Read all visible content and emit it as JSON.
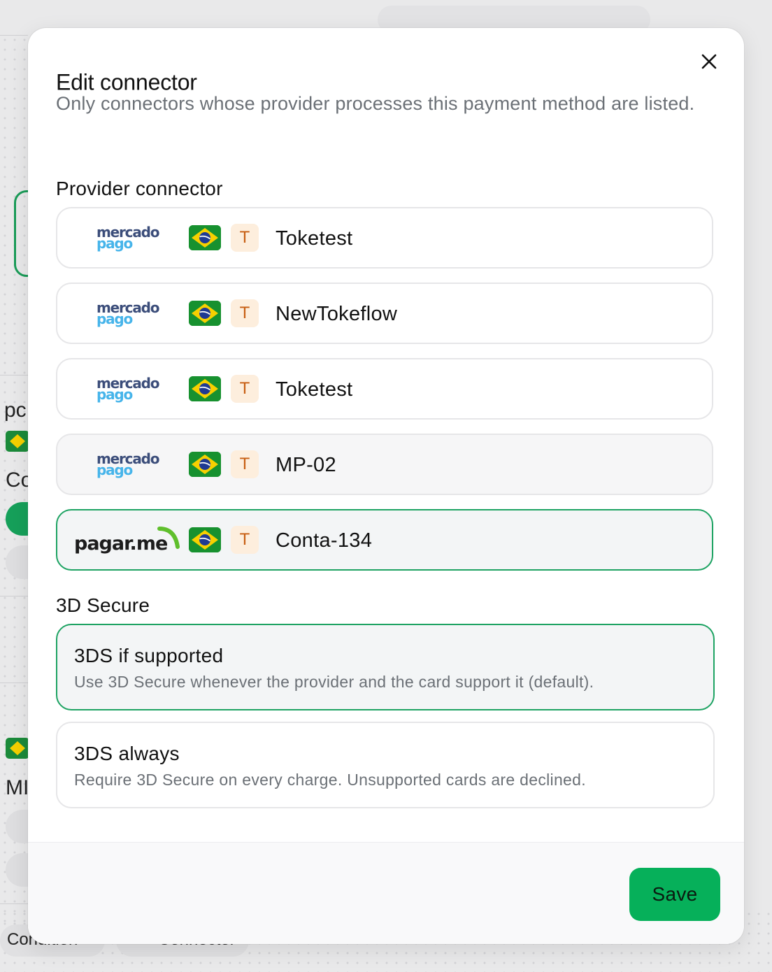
{
  "background": {
    "left_texts": [
      "pc",
      "Co",
      "MI"
    ],
    "bottom_tabs": [
      "Condition",
      "Connector"
    ]
  },
  "modal": {
    "title": "Edit connector",
    "description": "Only connectors whose provider processes this payment method are listed.",
    "provider_section_label": "Provider connector",
    "connectors": [
      {
        "provider": "mercado pago",
        "logo_lines": [
          "mercado",
          "pago"
        ],
        "country_flag": "brazil-flag-icon",
        "badge": "T",
        "name": "Toketest",
        "state": "default"
      },
      {
        "provider": "mercado pago",
        "logo_lines": [
          "mercado",
          "pago"
        ],
        "country_flag": "brazil-flag-icon",
        "badge": "T",
        "name": "NewTokeflow",
        "state": "default"
      },
      {
        "provider": "mercado pago",
        "logo_lines": [
          "mercado",
          "pago"
        ],
        "country_flag": "brazil-flag-icon",
        "badge": "T",
        "name": "Toketest",
        "state": "default"
      },
      {
        "provider": "mercado pago",
        "logo_lines": [
          "mercado",
          "pago"
        ],
        "country_flag": "brazil-flag-icon",
        "badge": "T",
        "name": "MP-02",
        "state": "hover"
      },
      {
        "provider": "pagar.me",
        "logo_text": "pagar.me",
        "country_flag": "brazil-flag-icon",
        "badge": "T",
        "name": "Conta-134",
        "state": "selected"
      }
    ],
    "three_ds_section_label": "3D Secure",
    "three_ds_options": [
      {
        "title": "3DS if supported",
        "description": "Use 3D Secure whenever the provider and the card support it (default).",
        "selected": true
      },
      {
        "title": "3DS always",
        "description": "Require 3D Secure on every charge. Unsupported cards are declined.",
        "selected": false
      }
    ],
    "save_label": "Save"
  },
  "colors": {
    "accent_green": "#06b05a",
    "selected_border": "#1ea363",
    "badge_bg": "#fdeedd",
    "badge_text": "#c75e12"
  }
}
